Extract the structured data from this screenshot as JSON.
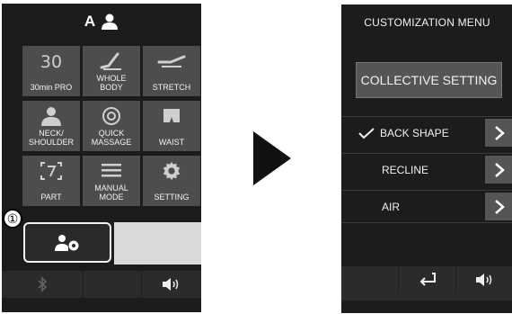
{
  "left": {
    "header_label": "A",
    "tiles": [
      {
        "label": "30min PRO",
        "icon": "30-timer-icon"
      },
      {
        "label": "WHOLE\nBODY",
        "icon": "recliner-icon"
      },
      {
        "label": "STRETCH",
        "icon": "stretch-icon"
      },
      {
        "label": "NECK/\nSHOULDER",
        "icon": "neck-shoulder-icon"
      },
      {
        "label": "QUICK\nMASSAGE",
        "icon": "quick-massage-icon"
      },
      {
        "label": "WAIST",
        "icon": "waist-icon"
      },
      {
        "label": "PART",
        "icon": "part-icon"
      },
      {
        "label": "MANUAL\nMODE",
        "icon": "manual-mode-icon"
      },
      {
        "label": "SETTING",
        "icon": "gear-icon"
      }
    ],
    "callout_number": "①"
  },
  "right": {
    "title": "CUSTOMIZATION MENU",
    "collective_label": "COLLECTIVE SETTING",
    "menu": [
      {
        "label": "BACK SHAPE",
        "checked": true
      },
      {
        "label": "RECLINE",
        "checked": false
      },
      {
        "label": "AIR",
        "checked": false
      }
    ]
  },
  "colors": {
    "panel_bg": "#1c1c1c",
    "tile_bg": "#4d4d4d",
    "text": "#f2f2f2"
  }
}
